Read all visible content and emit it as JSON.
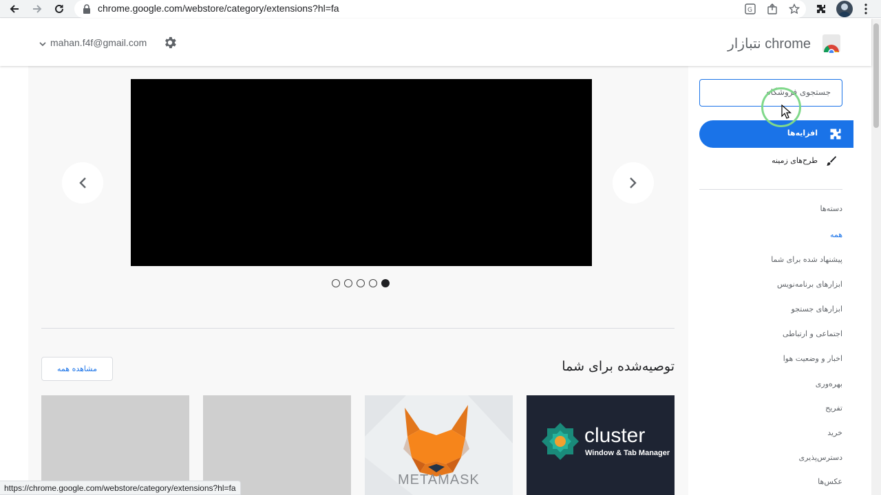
{
  "browser": {
    "url": "chrome.google.com/webstore/category/extensions?hl=fa",
    "status_url": "https://chrome.google.com/webstore/category/extensions?hl=fa",
    "icons": [
      "back-icon",
      "forward-icon",
      "reload-icon",
      "lock-icon",
      "translate-icon",
      "share-icon",
      "star-icon",
      "extensions-icon",
      "avatar",
      "menu-icon"
    ]
  },
  "header": {
    "brand": "chrome نتبازار",
    "account": "mahan.f4f@gmail.com",
    "settings_icon": "gear-icon"
  },
  "sidebar": {
    "search_placeholder": "جستجوی فروشگاه",
    "nav": [
      {
        "label": "افزایه‌ها",
        "icon": "puzzle-icon",
        "active": true
      },
      {
        "label": "طرح‌های زمینه",
        "icon": "brush-icon",
        "active": false
      }
    ],
    "categories_heading": "دسته‌ها",
    "categories": [
      {
        "label": "همه",
        "active": true
      },
      {
        "label": "پیشنهاد شده برای شما"
      },
      {
        "label": "ابزارهای برنامه‌نویس"
      },
      {
        "label": "ابزارهای جستجو"
      },
      {
        "label": "اجتماعی و ارتباطی"
      },
      {
        "label": "اخبار و وضعیت هوا"
      },
      {
        "label": "بهره‌وری"
      },
      {
        "label": "تفریح"
      },
      {
        "label": "خرید"
      },
      {
        "label": "دسترس‌پذیری"
      },
      {
        "label": "عکس‌ها"
      }
    ]
  },
  "main": {
    "carousel": {
      "slide_count": 5,
      "active_index": 4
    },
    "section_title": "توصیه‌شده برای شما",
    "view_all": "مشاهده همه",
    "tiles": [
      {
        "name": "cluster",
        "title": "cluster",
        "subtitle": "Window & Tab Manager"
      },
      {
        "name": "metamask",
        "title": "METAMASK"
      },
      {
        "name": "placeholder"
      },
      {
        "name": "placeholder"
      }
    ]
  },
  "colors": {
    "accent": "#1a73e8",
    "tile_placeholder": "#cfcfcf",
    "cluster_bg": "#1e2433"
  }
}
